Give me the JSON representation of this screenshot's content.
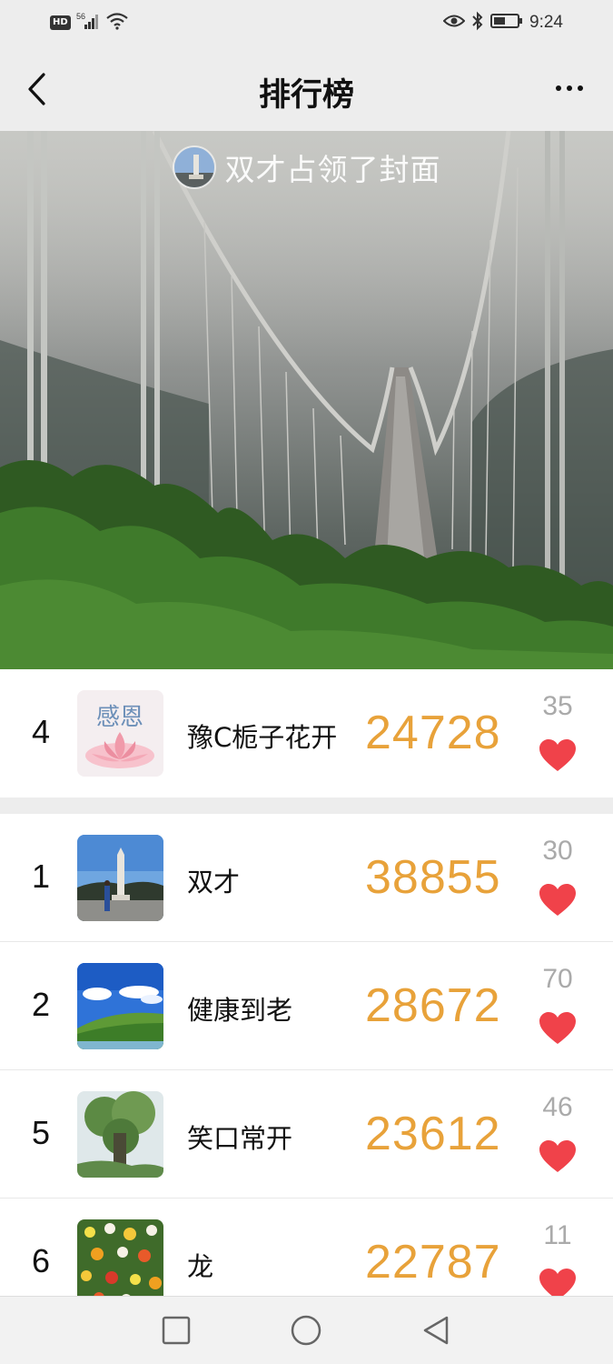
{
  "status_bar": {
    "hd": "HD",
    "signal": "56",
    "time": "9:24"
  },
  "nav": {
    "title": "排行榜"
  },
  "cover": {
    "caption": "双才占领了封面"
  },
  "my_rank": {
    "rank": "4",
    "name": "豫C栀子花开",
    "score": "24728",
    "likes": "35",
    "thumb_text": "感恩"
  },
  "ranking": [
    {
      "rank": "1",
      "name": "双才",
      "score": "38855",
      "likes": "30"
    },
    {
      "rank": "2",
      "name": "健康到老",
      "score": "28672",
      "likes": "70"
    },
    {
      "rank": "5",
      "name": "笑口常开",
      "score": "23612",
      "likes": "46"
    },
    {
      "rank": "6",
      "name": "龙",
      "score": "22787",
      "likes": "11"
    }
  ],
  "colors": {
    "score": "#e8a23a",
    "heart": "#f0424a",
    "background": "#ededed"
  },
  "icons": {
    "back": "chevron-left-icon",
    "more": "more-dots-icon",
    "heart": "heart-icon",
    "recent": "square-icon",
    "home": "circle-icon",
    "back_sys": "triangle-back-icon"
  }
}
